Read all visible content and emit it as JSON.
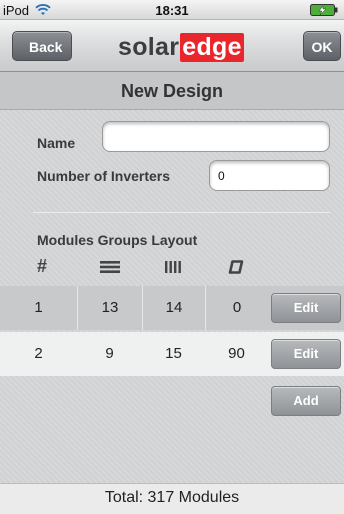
{
  "status_bar": {
    "carrier": "iPod",
    "time": "18:31"
  },
  "nav": {
    "back_label": "Back",
    "logo_part1": "solar",
    "logo_part2": "edge",
    "ok_label": "OK"
  },
  "page": {
    "title": "New Design"
  },
  "form": {
    "name_label": "Name",
    "name_value": "",
    "inverters_label": "Number of Inverters",
    "inverters_value": "0"
  },
  "modules": {
    "title": "Modules Groups Layout",
    "columns": [
      "#",
      "rows-icon",
      "columns-icon",
      "tilt-icon"
    ],
    "rows": [
      {
        "index": "1",
        "rows": "13",
        "cols": "14",
        "tilt": "0",
        "action": "Edit"
      },
      {
        "index": "2",
        "rows": "9",
        "cols": "15",
        "tilt": "90",
        "action": "Edit"
      }
    ],
    "add_label": "Add"
  },
  "footer": {
    "total": "Total: 317 Modules"
  },
  "colors": {
    "brand_red": "#e9262c",
    "logo_gray": "#3c3d40"
  }
}
